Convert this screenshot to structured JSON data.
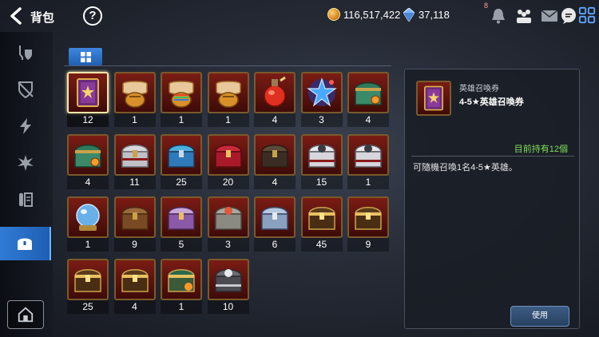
{
  "header": {
    "title": "背包",
    "help_label": "?",
    "gold": "116,517,422",
    "gems": "37,118",
    "notification_count": "8"
  },
  "sidebar": {
    "items": [
      {
        "icon": "sword-shield-icon",
        "active": false
      },
      {
        "icon": "broken-shield-icon",
        "active": false
      },
      {
        "icon": "lightning-icon",
        "active": false
      },
      {
        "icon": "shard-burst-icon",
        "active": false
      },
      {
        "icon": "scroll-swap-icon",
        "active": false
      },
      {
        "icon": "treasure-chest-icon",
        "active": true
      }
    ],
    "bottom_icon": "house-icon"
  },
  "tabs": [
    {
      "icon": "grid-icon",
      "active": true
    }
  ],
  "items": [
    {
      "icon": "hero-summon-ticket-icon",
      "count": "12",
      "selected": true
    },
    {
      "icon": "scroll-pouch-icon",
      "count": "1"
    },
    {
      "icon": "rainbow-scroll-pouch-icon",
      "count": "1"
    },
    {
      "icon": "scroll-pouch-icon",
      "count": "1"
    },
    {
      "icon": "potion-icon",
      "count": "4"
    },
    {
      "icon": "star-badge-icon",
      "count": "3"
    },
    {
      "icon": "green-chest-icon",
      "count": "4"
    },
    {
      "icon": "green-chest-icon",
      "count": "4"
    },
    {
      "icon": "silver-chest-icon",
      "count": "11"
    },
    {
      "icon": "blue-chest-icon",
      "count": "25"
    },
    {
      "icon": "red-chest-icon",
      "count": "20"
    },
    {
      "icon": "dark-chest-icon",
      "count": "4"
    },
    {
      "icon": "skull-chest-icon",
      "count": "15"
    },
    {
      "icon": "skull-chest-icon",
      "count": "1"
    },
    {
      "icon": "crystal-orb-icon",
      "count": "1"
    },
    {
      "icon": "wood-chest-icon",
      "count": "9"
    },
    {
      "icon": "purple-chest-icon",
      "count": "5"
    },
    {
      "icon": "stone-chest-icon",
      "count": "3"
    },
    {
      "icon": "steel-chest-icon",
      "count": "6"
    },
    {
      "icon": "gold-chest-icon",
      "count": "45"
    },
    {
      "icon": "gold-chest-icon",
      "count": "9"
    },
    {
      "icon": "gold-chest-icon",
      "count": "25"
    },
    {
      "icon": "gold-chest-icon",
      "count": "4"
    },
    {
      "icon": "green-gold-chest-icon",
      "count": "1"
    },
    {
      "icon": "iron-chest-icon",
      "count": "10"
    }
  ],
  "detail": {
    "category": "英雄召喚券",
    "name": "4-5★英雄召喚券",
    "owned": "目前持有12個",
    "description": "可隨機召喚1名4-5★英雄。",
    "use_label": "使用"
  },
  "colors": {
    "accent_blue": "#2f7bd6",
    "owned_green": "#7de05a",
    "slot_red": "#7a1c14",
    "slot_border_gold": "#7a5a2a"
  }
}
